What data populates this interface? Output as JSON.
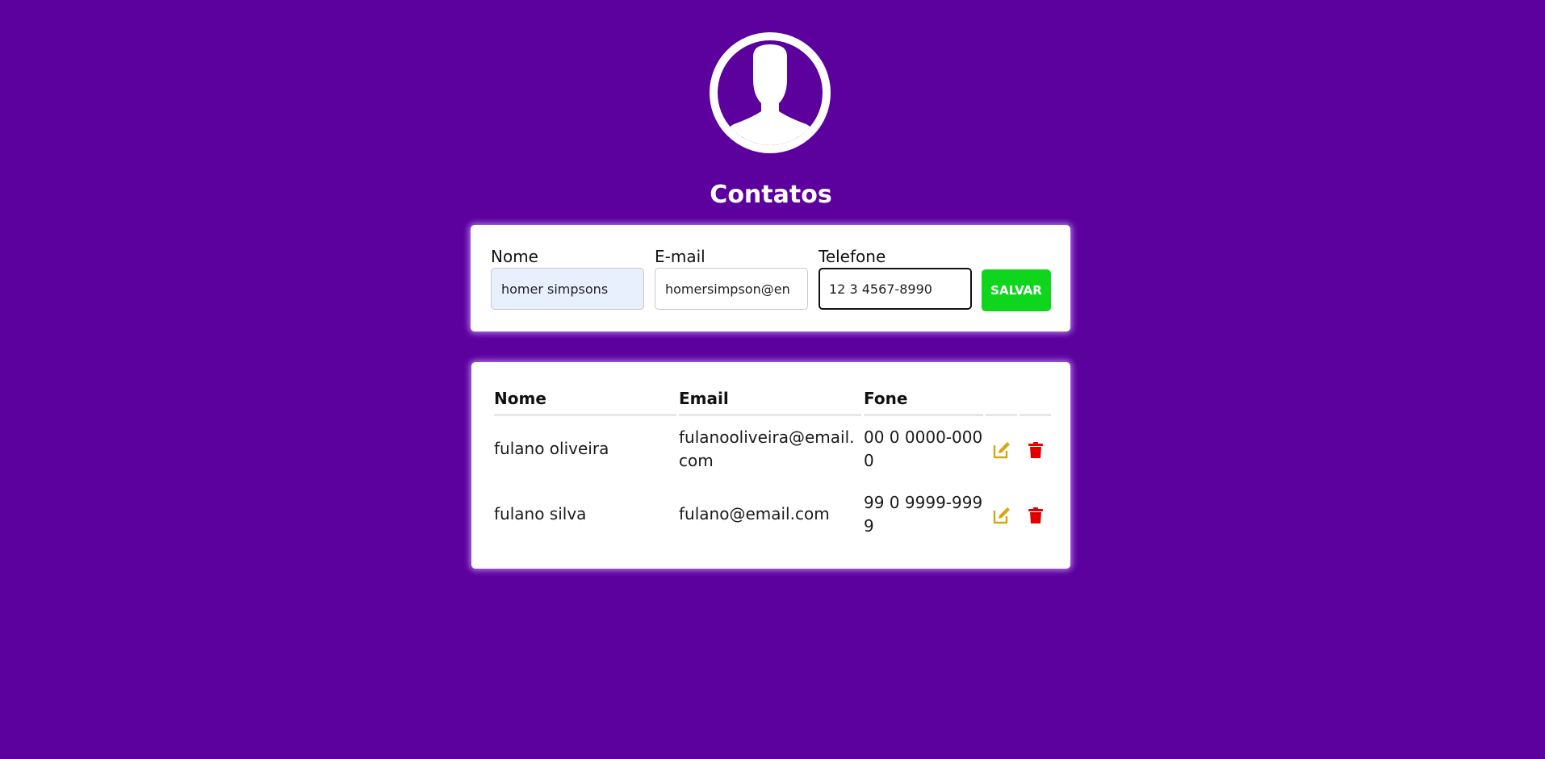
{
  "header": {
    "title": "Contatos",
    "avatar_icon": "user-silhouette-icon"
  },
  "form": {
    "nome_label": "Nome",
    "nome_value": "homer simpsons",
    "email_label": "E-mail",
    "email_value": "homersimpson@en",
    "telefone_label": "Telefone",
    "telefone_value": "12 3 4567-8990",
    "save_label": "SALVAR"
  },
  "table": {
    "headers": [
      "Nome",
      "Email",
      "Fone"
    ],
    "rows": [
      {
        "nome": "fulano oliveira",
        "email": "fulanooliveira@email.com",
        "fone": "00 0 0000-0000"
      },
      {
        "nome": "fulano silva",
        "email": "fulano@email.com",
        "fone": "99 0 9999-9999"
      }
    ],
    "edit_icon": "edit-icon",
    "delete_icon": "trash-icon"
  },
  "colors": {
    "background": "#5c009e",
    "save_button": "#0fd61c",
    "edit_icon": "#d4a90f",
    "delete_icon": "#e00000"
  }
}
